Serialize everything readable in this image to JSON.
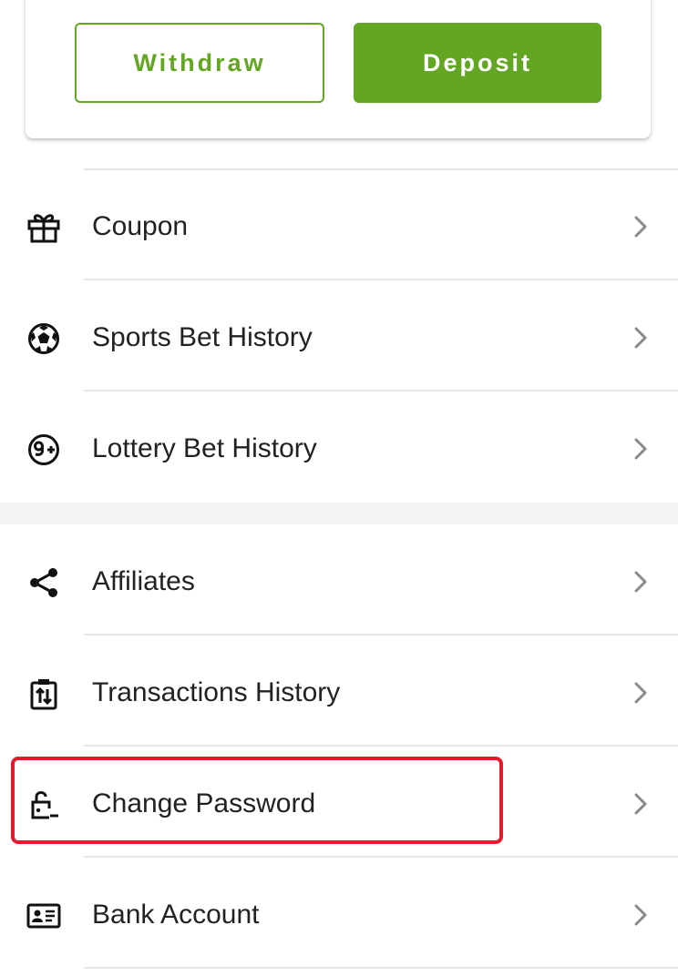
{
  "wallet": {
    "withdraw_label": "Withdraw",
    "deposit_label": "Deposit",
    "accent_color": "#63a621"
  },
  "menu": {
    "group1": [
      {
        "label": "Coupon",
        "icon": "gift-icon"
      },
      {
        "label": "Sports Bet History",
        "icon": "soccer-ball-icon"
      },
      {
        "label": "Lottery Bet History",
        "icon": "lottery-nine-plus-icon"
      }
    ],
    "group2": [
      {
        "label": "Affiliates",
        "icon": "share-icon"
      },
      {
        "label": "Transactions History",
        "icon": "transactions-clipboard-icon"
      },
      {
        "label": "Change Password",
        "icon": "unlock-password-icon"
      },
      {
        "label": "Bank Account",
        "icon": "id-card-icon"
      }
    ]
  },
  "highlight": {
    "target": "Change Password",
    "color": "#e8192c"
  }
}
